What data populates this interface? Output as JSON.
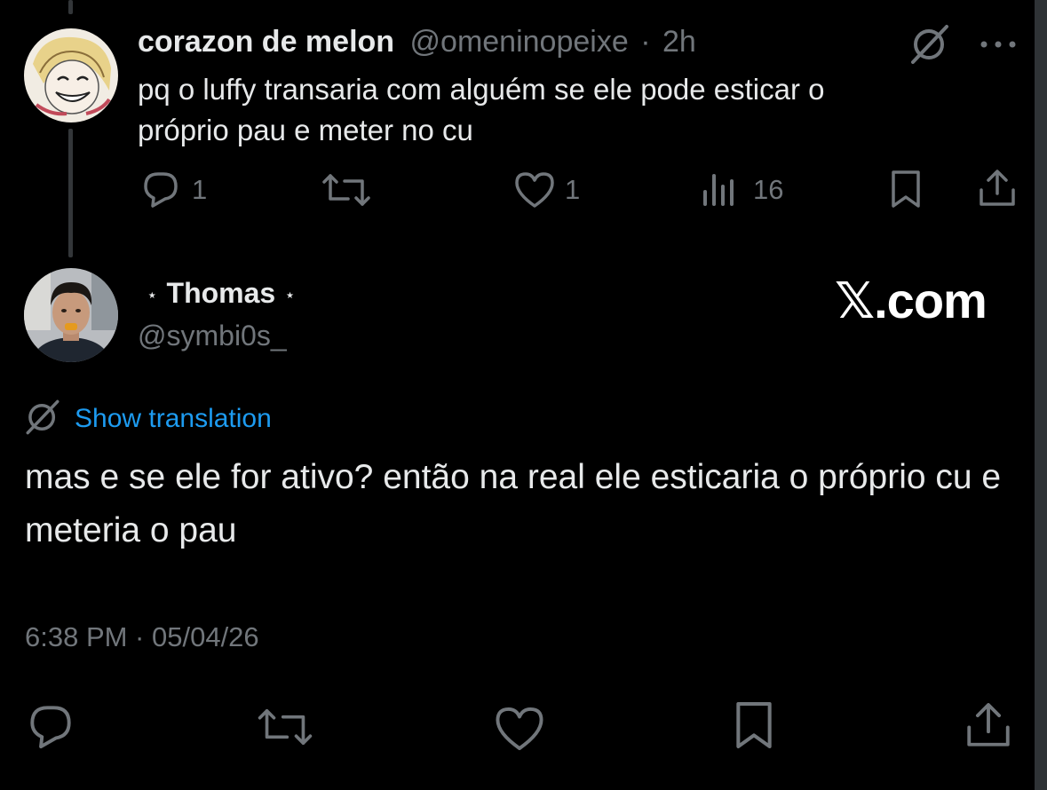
{
  "parent_tweet": {
    "display_name": "corazon de melon",
    "handle": "@omeninopeixe",
    "separator": "·",
    "time_ago": "2h",
    "text": "pq o luffy transaria com alguém se ele pode esticar o próprio pau e meter no cu",
    "reply_count": "1",
    "like_count": "1",
    "view_count": "16",
    "icons": [
      "translate-icon",
      "more-icon",
      "reply-icon",
      "retweet-icon",
      "like-icon",
      "views-icon",
      "bookmark-icon",
      "share-icon"
    ]
  },
  "reply_tweet": {
    "star_left": "⋆",
    "display_name": "Thomas",
    "star_right": "⋆",
    "handle": "@symbi0s_",
    "watermark": "𝕏.com",
    "translation_label": "Show translation",
    "text": "mas e se ele for ativo? então na real ele esticaria o próprio cu e meteria o pau",
    "timestamp": "6:38 PM · 05/04/26",
    "icons": [
      "translate-icon",
      "reply-icon",
      "retweet-icon",
      "like-icon",
      "bookmark-icon",
      "share-icon"
    ]
  },
  "colors": {
    "background": "#000000",
    "text_primary": "#e7e9ea",
    "text_secondary": "#71767b",
    "link": "#1d9bf0",
    "thread_line": "#333639"
  }
}
